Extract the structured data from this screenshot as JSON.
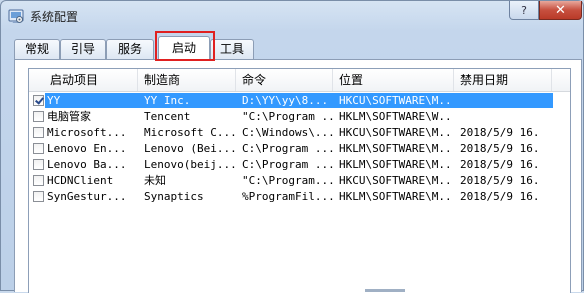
{
  "window": {
    "title": "系统配置",
    "help_label": "?",
    "close_label": "✕"
  },
  "tabs": [
    {
      "label": "常规",
      "active": false
    },
    {
      "label": "引导",
      "active": false
    },
    {
      "label": "服务",
      "active": false
    },
    {
      "label": "启动",
      "active": true
    },
    {
      "label": "工具",
      "active": false
    }
  ],
  "listview": {
    "columns": [
      "启动项目",
      "制造商",
      "命令",
      "位置",
      "禁用日期"
    ],
    "rows": [
      {
        "checked": true,
        "selected": true,
        "name": "YY",
        "manufacturer": "YY Inc.",
        "command": "D:\\YY\\yy\\8...",
        "location": "HKCU\\SOFTWARE\\M...",
        "disabled_date": ""
      },
      {
        "checked": false,
        "selected": false,
        "name": "电脑管家",
        "manufacturer": "Tencent",
        "command": "\"C:\\Program ...",
        "location": "HKLM\\SOFTWARE\\W...",
        "disabled_date": ""
      },
      {
        "checked": false,
        "selected": false,
        "name": "Microsoft...",
        "manufacturer": "Microsoft C...",
        "command": "C:\\Windows\\...",
        "location": "HKCU\\SOFTWARE\\M...",
        "disabled_date": "2018/5/9 16..."
      },
      {
        "checked": false,
        "selected": false,
        "name": "Lenovo En...",
        "manufacturer": "Lenovo (Bei...",
        "command": "C:\\Program ...",
        "location": "HKLM\\SOFTWARE\\M...",
        "disabled_date": "2018/5/9 16..."
      },
      {
        "checked": false,
        "selected": false,
        "name": "Lenovo Ba...",
        "manufacturer": "Lenovo(beij...",
        "command": "C:\\Program ...",
        "location": "HKLM\\SOFTWARE\\M...",
        "disabled_date": "2018/5/9 16..."
      },
      {
        "checked": false,
        "selected": false,
        "name": "HCDNClient",
        "manufacturer": "未知",
        "command": "\"C:\\Program...",
        "location": "HKCU\\SOFTWARE\\M...",
        "disabled_date": "2018/5/9 16..."
      },
      {
        "checked": false,
        "selected": false,
        "name": "SynGestur...",
        "manufacturer": "Synaptics",
        "command": "%ProgramFil...",
        "location": "HKLM\\SOFTWARE\\M...",
        "disabled_date": "2018/5/9 16..."
      }
    ]
  },
  "colors": {
    "selection": "#3399ff",
    "highlight_box": "#e02020",
    "close_button": "#c7503f"
  }
}
